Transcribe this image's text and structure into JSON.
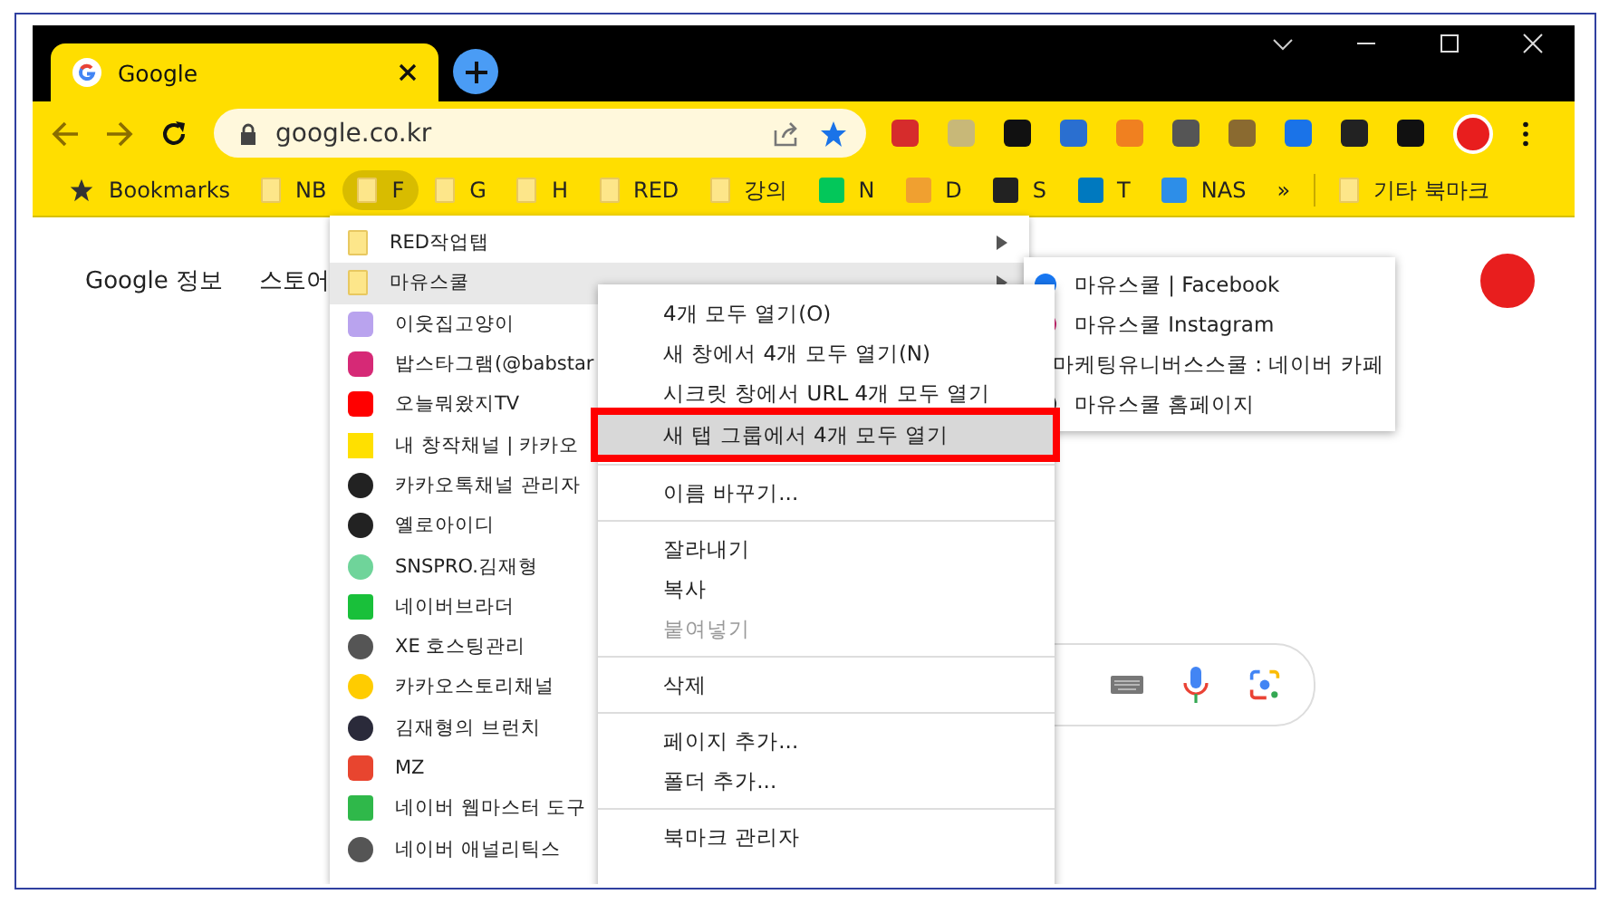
{
  "tabs": [
    {
      "title": "Google",
      "selected": true
    }
  ],
  "address_bar": {
    "url": "google.co.kr"
  },
  "bookmarks_bar": {
    "items": [
      {
        "label": "Bookmarks",
        "kind": "star",
        "selected": false
      },
      {
        "label": "NB",
        "kind": "folder",
        "selected": false
      },
      {
        "label": "F",
        "kind": "folder",
        "selected": true
      },
      {
        "label": "G",
        "kind": "folder",
        "selected": false
      },
      {
        "label": "H",
        "kind": "folder",
        "selected": false
      },
      {
        "label": "RED",
        "kind": "folder",
        "selected": false
      },
      {
        "label": "강의",
        "kind": "folder",
        "selected": false
      },
      {
        "label": "N",
        "kind": "site",
        "selected": false
      },
      {
        "label": "D",
        "kind": "site",
        "selected": false
      },
      {
        "label": "S",
        "kind": "site",
        "selected": false
      },
      {
        "label": "T",
        "kind": "site",
        "selected": false
      },
      {
        "label": "NAS",
        "kind": "site",
        "selected": false
      }
    ],
    "overflow_button": "»",
    "other_bookmarks": "기타 북마크"
  },
  "page": {
    "links": [
      "Google 정보",
      "스토어"
    ]
  },
  "folder_menu": {
    "items": [
      {
        "label": "RED작업탭",
        "kind": "folder",
        "selected": false
      },
      {
        "label": "마유스쿨",
        "kind": "folder",
        "selected": true
      },
      {
        "label": "이웃집고양이",
        "kind": "site",
        "selected": false
      },
      {
        "label": "밥스타그램(@babstar",
        "kind": "site",
        "selected": false
      },
      {
        "label": "오늘뭐왔지TV",
        "kind": "site",
        "selected": false
      },
      {
        "label": "내 창작채널 | 카카오",
        "kind": "site",
        "selected": false
      },
      {
        "label": "카카오톡채널 관리자",
        "kind": "site",
        "selected": false
      },
      {
        "label": "옐로아이디",
        "kind": "site",
        "selected": false
      },
      {
        "label": "SNSPRO.김재형",
        "kind": "site",
        "selected": false
      },
      {
        "label": "네이버브라더",
        "kind": "site",
        "selected": false
      },
      {
        "label": "XE 호스팅관리",
        "kind": "site",
        "selected": false
      },
      {
        "label": "카카오스토리채널",
        "kind": "site",
        "selected": false
      },
      {
        "label": "김재형의 브런치",
        "kind": "site",
        "selected": false
      },
      {
        "label": "MZ",
        "kind": "site",
        "selected": false
      },
      {
        "label": "네이버 웹마스터 도구",
        "kind": "site",
        "selected": false
      },
      {
        "label": "네이버 애널리틱스",
        "kind": "site",
        "selected": false
      }
    ]
  },
  "context_menu": {
    "groups": [
      {
        "items": [
          {
            "label": "4개 모두 열기(O)",
            "disabled": false,
            "selected": false
          },
          {
            "label": "새 창에서 4개 모두 열기(N)",
            "disabled": false,
            "selected": false
          },
          {
            "label": "시크릿 창에서 URL 4개 모두 열기",
            "disabled": false,
            "selected": false
          },
          {
            "label": "새 탭 그룹에서 4개 모두 열기",
            "disabled": false,
            "selected": true
          }
        ]
      },
      {
        "items": [
          {
            "label": "이름 바꾸기...",
            "disabled": false,
            "selected": false
          }
        ]
      },
      {
        "items": [
          {
            "label": "잘라내기",
            "disabled": false,
            "selected": false
          },
          {
            "label": "복사",
            "disabled": false,
            "selected": false
          },
          {
            "label": "붙여넣기",
            "disabled": true,
            "selected": false
          }
        ]
      },
      {
        "items": [
          {
            "label": "삭제",
            "disabled": false,
            "selected": false
          }
        ]
      },
      {
        "items": [
          {
            "label": "페이지 추가...",
            "disabled": false,
            "selected": false
          },
          {
            "label": "폴더 추가...",
            "disabled": false,
            "selected": false
          }
        ]
      },
      {
        "items": [
          {
            "label": "북마크 관리자",
            "disabled": false,
            "selected": false
          }
        ]
      }
    ]
  },
  "submenu": {
    "items": [
      {
        "label": "마유스쿨 | Facebook"
      },
      {
        "label": "마유스쿨 Instagram"
      },
      {
        "label": "마케팅유니버스스쿨 : 네이버 카페"
      },
      {
        "label": "마유스쿨 홈페이지"
      }
    ]
  }
}
